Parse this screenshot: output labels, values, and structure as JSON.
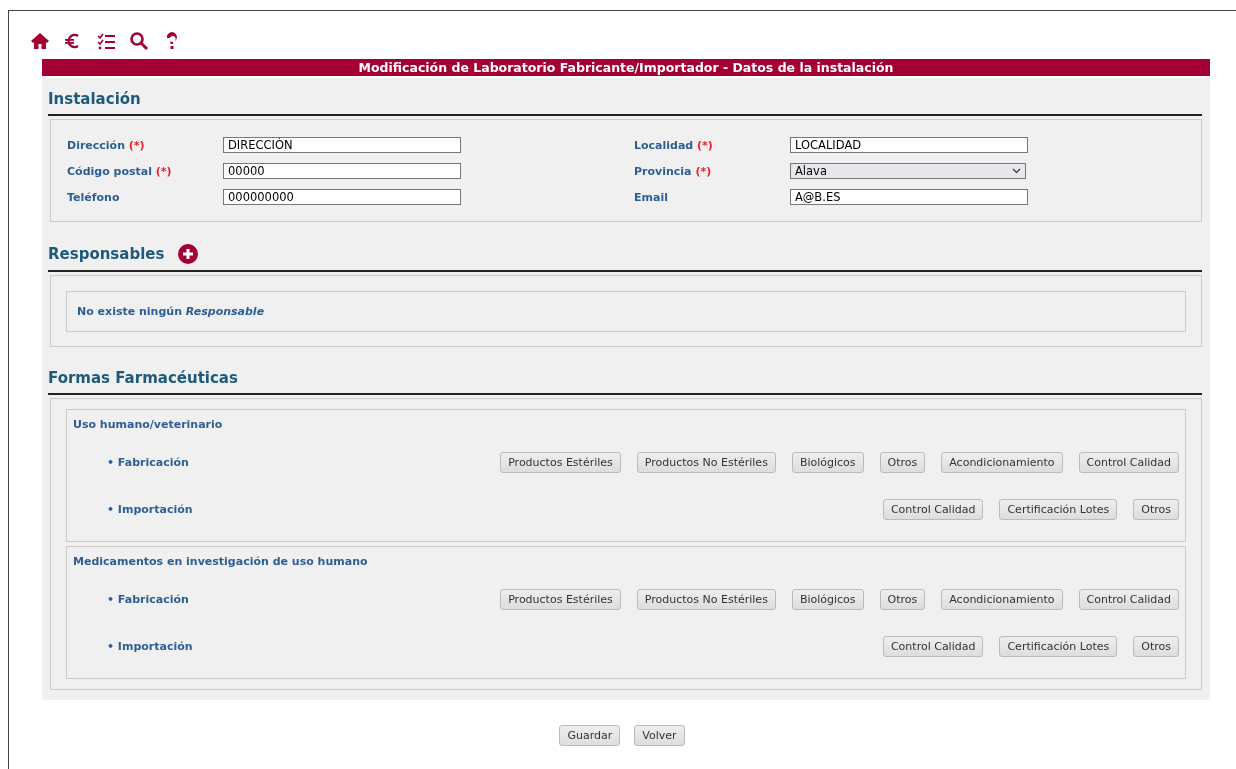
{
  "toolbar": [
    {
      "kind": "home"
    },
    {
      "kind": "euro"
    },
    {
      "kind": "checklist"
    },
    {
      "kind": "search"
    },
    {
      "kind": "help"
    }
  ],
  "title": "Modificación de Laboratorio Fabricante/Importador - Datos de la instalación",
  "instalacion": {
    "heading": "Instalación",
    "columns": [
      [
        {
          "label": "Dirección",
          "required_mark": "(*)",
          "kind": "text",
          "value": "DIRECCIÓN"
        },
        {
          "label": "Código postal",
          "required_mark": "(*)",
          "kind": "text",
          "value": "00000"
        },
        {
          "label": "Teléfono",
          "kind": "text",
          "value": "000000000"
        }
      ],
      [
        {
          "label": "Localidad",
          "required_mark": "(*)",
          "kind": "text",
          "value": "LOCALIDAD"
        },
        {
          "label": "Provincia",
          "required_mark": "(*)",
          "kind": "select",
          "value": "Alava"
        },
        {
          "label": "Email",
          "kind": "text",
          "value": "A@B.ES"
        }
      ]
    ]
  },
  "responsables": {
    "heading": "Responsables",
    "empty_message": "No existe ningún *Responsable*"
  },
  "formas": {
    "heading": "Formas Farmacéuticas",
    "groups": [
      {
        "title": "Uso humano/veterinario",
        "rows": [
          {
            "label": "• Fabricación",
            "buttons": [
              "Productos Estériles",
              "Productos No Estériles",
              "Biológicos",
              "Otros",
              "Acondicionamiento",
              "Control Calidad"
            ]
          },
          {
            "label": "• Importación",
            "buttons": [
              "Control Calidad",
              "Certificación Lotes",
              "Otros"
            ]
          }
        ]
      },
      {
        "title": "Medicamentos en investigación de uso humano",
        "rows": [
          {
            "label": "• Fabricación",
            "buttons": [
              "Productos Estériles",
              "Productos No Estériles",
              "Biológicos",
              "Otros",
              "Acondicionamiento",
              "Control Calidad"
            ]
          },
          {
            "label": "• Importación",
            "buttons": [
              "Control Calidad",
              "Certificación Lotes",
              "Otros"
            ]
          }
        ]
      }
    ]
  },
  "actions": [
    "Guardar",
    "Volver"
  ]
}
